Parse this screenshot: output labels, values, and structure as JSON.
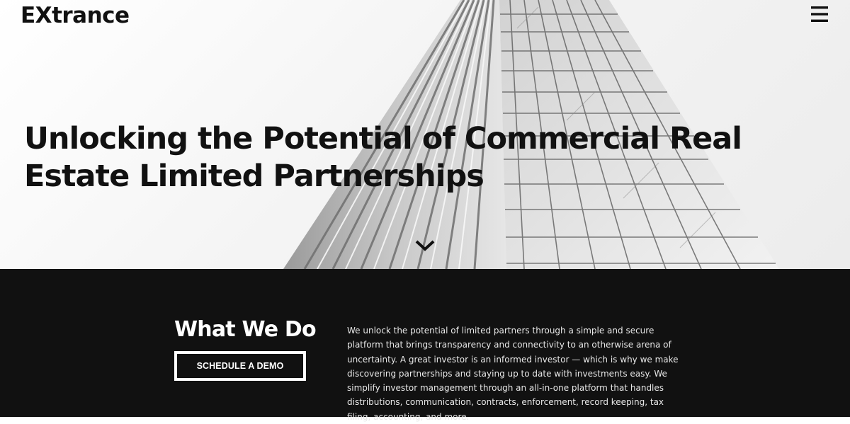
{
  "header": {
    "logo": "EXtrance",
    "menu_icon": "hamburger-menu-icon"
  },
  "hero": {
    "headline": "Unlocking the Potential of Commercial Real Estate Limited Partnerships",
    "scroll_icon": "chevron-down-icon"
  },
  "what_we_do": {
    "title": "What We Do",
    "button_label": "SCHEDULE A DEMO",
    "description": "We unlock the potential of limited partners through a simple and secure platform that brings transparency and connectivity to an otherwise arena of uncertainty. A great investor is an informed investor — which is why we make discovering partnerships and staying up to date with investments easy. We simplify investor management through an all-in-one platform that handles distributions, communication, contracts, enforcement, record keeping, tax filing, accounting, and more."
  },
  "colors": {
    "dark_section_bg": "#111111",
    "text_dark": "#111111",
    "text_light": "#ffffff"
  }
}
